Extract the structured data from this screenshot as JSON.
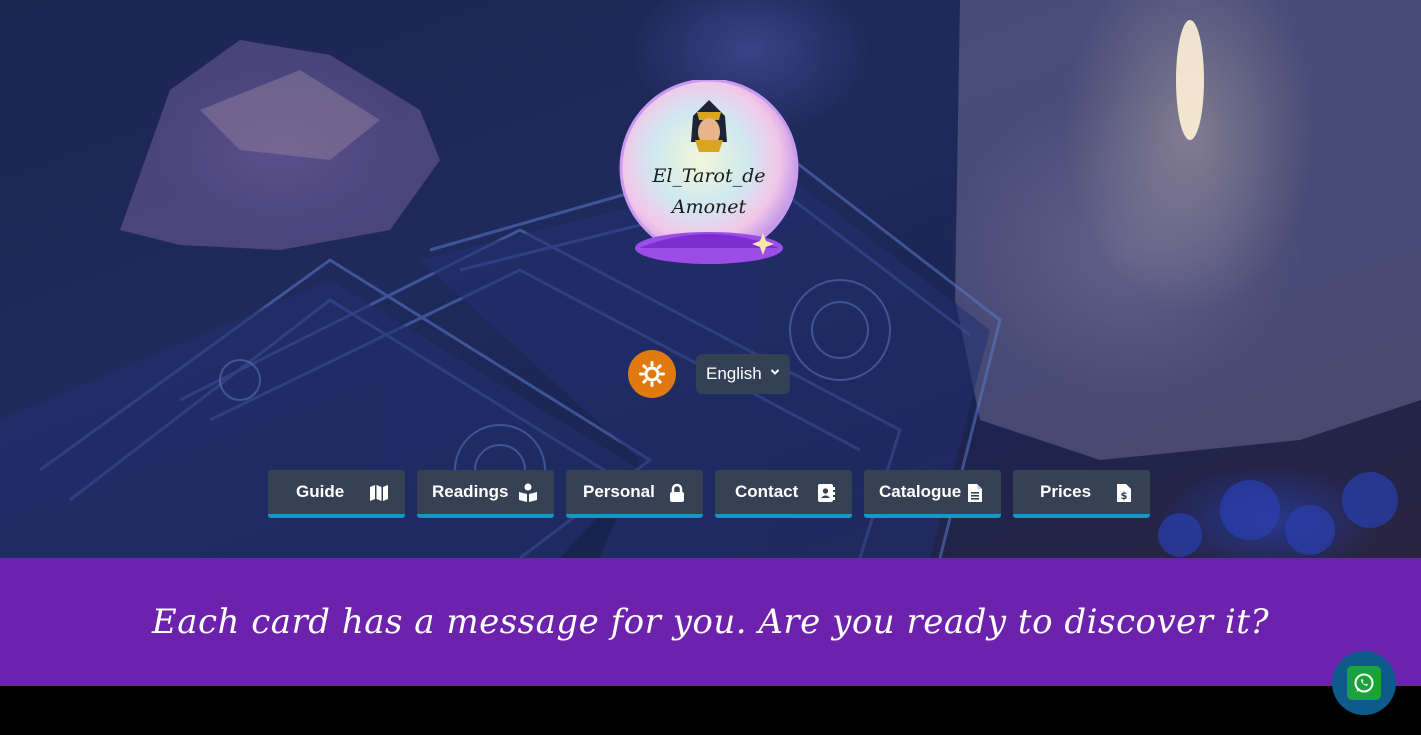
{
  "logo": {
    "line1": "El_Tarot_de",
    "line2": "Amonet"
  },
  "controls": {
    "theme_icon": "sun-icon",
    "language": {
      "selected": "English",
      "icon": "chevron-down-icon"
    }
  },
  "nav": {
    "items": [
      {
        "label": "Guide",
        "icon": "map-icon"
      },
      {
        "label": "Readings",
        "icon": "book-reader-icon"
      },
      {
        "label": "Personal",
        "icon": "lock-icon"
      },
      {
        "label": "Contact",
        "icon": "address-book-icon"
      },
      {
        "label": "Catalogue",
        "icon": "file-icon"
      },
      {
        "label": "Prices",
        "icon": "file-invoice-dollar-icon"
      }
    ]
  },
  "banner": {
    "text": "Each card has a message for you. Are you ready to discover it?"
  },
  "whatsapp": {
    "icon": "whatsapp-icon"
  },
  "colors": {
    "banner_bg": "#6c22ad",
    "nav_bg": "#364153",
    "nav_accent": "#1497c6",
    "theme_button": "#e07a10",
    "whatsapp_green": "#1aa33a"
  }
}
